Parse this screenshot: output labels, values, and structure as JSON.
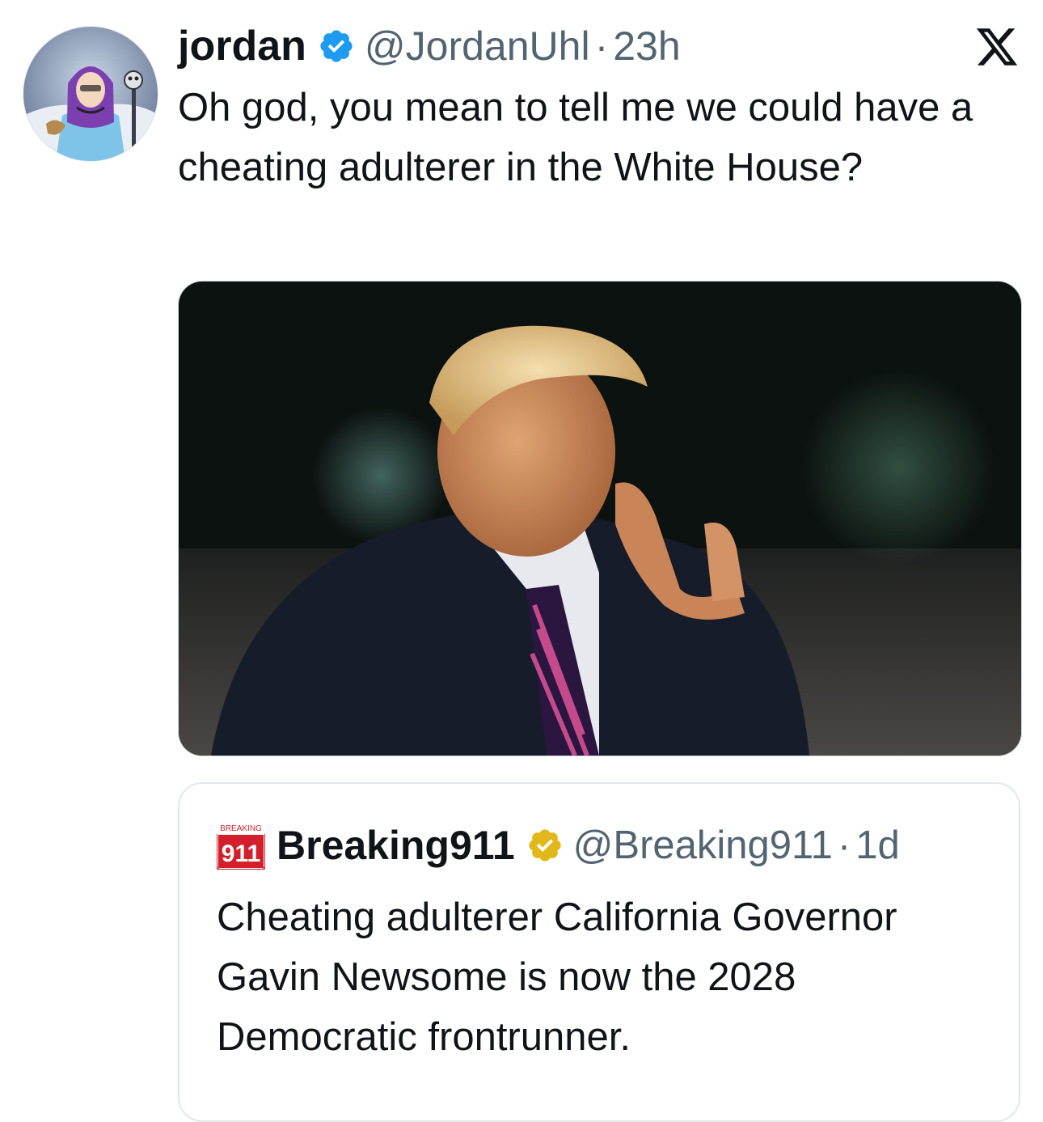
{
  "tweet": {
    "author": {
      "display_name": "jordan",
      "handle": "@JordanUhl",
      "verified_badge": "blue-check-icon",
      "avatar": "cartoon-avatar-purple-hood"
    },
    "separator": "·",
    "time": "23h",
    "brand_icon": "x-logo-icon",
    "text": "Oh god, you mean to tell me we could have a cheating adulterer in the White House?",
    "media": {
      "description_icon": "photo-man-in-suit-night"
    }
  },
  "quoted_tweet": {
    "author": {
      "display_name": "Breaking911",
      "handle": "@Breaking911",
      "verified_badge": "gold-check-icon",
      "avatar_text_top": "BREAKING",
      "avatar_text_main": "911"
    },
    "separator": "·",
    "time": "1d",
    "text": "Cheating adulterer California Governor Gavin Newsome is now the 2028 Democratic frontrunner."
  },
  "colors": {
    "text_primary": "#0f1419",
    "text_secondary": "#536471",
    "verified_blue": "#1d9bf0",
    "verified_gold": "#e2b719",
    "border": "#e1e8ed"
  }
}
